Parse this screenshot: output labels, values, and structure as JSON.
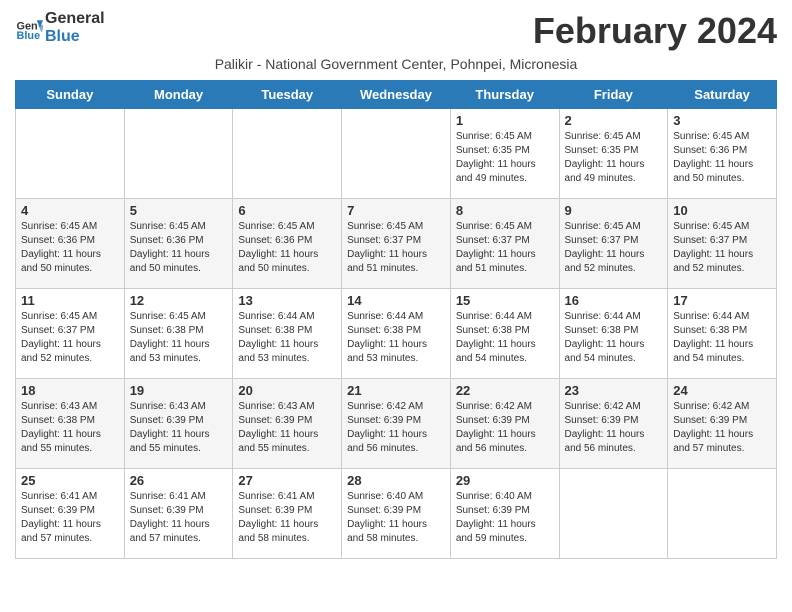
{
  "header": {
    "logo_line1": "General",
    "logo_line2": "Blue",
    "month_title": "February 2024",
    "subtitle": "Palikir - National Government Center, Pohnpei, Micronesia"
  },
  "days_of_week": [
    "Sunday",
    "Monday",
    "Tuesday",
    "Wednesday",
    "Thursday",
    "Friday",
    "Saturday"
  ],
  "weeks": [
    [
      {
        "day": "",
        "sunrise": "",
        "sunset": "",
        "daylight": ""
      },
      {
        "day": "",
        "sunrise": "",
        "sunset": "",
        "daylight": ""
      },
      {
        "day": "",
        "sunrise": "",
        "sunset": "",
        "daylight": ""
      },
      {
        "day": "",
        "sunrise": "",
        "sunset": "",
        "daylight": ""
      },
      {
        "day": "1",
        "sunrise": "6:45 AM",
        "sunset": "6:35 PM",
        "daylight": "11 hours and 49 minutes."
      },
      {
        "day": "2",
        "sunrise": "6:45 AM",
        "sunset": "6:35 PM",
        "daylight": "11 hours and 49 minutes."
      },
      {
        "day": "3",
        "sunrise": "6:45 AM",
        "sunset": "6:36 PM",
        "daylight": "11 hours and 50 minutes."
      }
    ],
    [
      {
        "day": "4",
        "sunrise": "6:45 AM",
        "sunset": "6:36 PM",
        "daylight": "11 hours and 50 minutes."
      },
      {
        "day": "5",
        "sunrise": "6:45 AM",
        "sunset": "6:36 PM",
        "daylight": "11 hours and 50 minutes."
      },
      {
        "day": "6",
        "sunrise": "6:45 AM",
        "sunset": "6:36 PM",
        "daylight": "11 hours and 50 minutes."
      },
      {
        "day": "7",
        "sunrise": "6:45 AM",
        "sunset": "6:37 PM",
        "daylight": "11 hours and 51 minutes."
      },
      {
        "day": "8",
        "sunrise": "6:45 AM",
        "sunset": "6:37 PM",
        "daylight": "11 hours and 51 minutes."
      },
      {
        "day": "9",
        "sunrise": "6:45 AM",
        "sunset": "6:37 PM",
        "daylight": "11 hours and 52 minutes."
      },
      {
        "day": "10",
        "sunrise": "6:45 AM",
        "sunset": "6:37 PM",
        "daylight": "11 hours and 52 minutes."
      }
    ],
    [
      {
        "day": "11",
        "sunrise": "6:45 AM",
        "sunset": "6:37 PM",
        "daylight": "11 hours and 52 minutes."
      },
      {
        "day": "12",
        "sunrise": "6:45 AM",
        "sunset": "6:38 PM",
        "daylight": "11 hours and 53 minutes."
      },
      {
        "day": "13",
        "sunrise": "6:44 AM",
        "sunset": "6:38 PM",
        "daylight": "11 hours and 53 minutes."
      },
      {
        "day": "14",
        "sunrise": "6:44 AM",
        "sunset": "6:38 PM",
        "daylight": "11 hours and 53 minutes."
      },
      {
        "day": "15",
        "sunrise": "6:44 AM",
        "sunset": "6:38 PM",
        "daylight": "11 hours and 54 minutes."
      },
      {
        "day": "16",
        "sunrise": "6:44 AM",
        "sunset": "6:38 PM",
        "daylight": "11 hours and 54 minutes."
      },
      {
        "day": "17",
        "sunrise": "6:44 AM",
        "sunset": "6:38 PM",
        "daylight": "11 hours and 54 minutes."
      }
    ],
    [
      {
        "day": "18",
        "sunrise": "6:43 AM",
        "sunset": "6:38 PM",
        "daylight": "11 hours and 55 minutes."
      },
      {
        "day": "19",
        "sunrise": "6:43 AM",
        "sunset": "6:39 PM",
        "daylight": "11 hours and 55 minutes."
      },
      {
        "day": "20",
        "sunrise": "6:43 AM",
        "sunset": "6:39 PM",
        "daylight": "11 hours and 55 minutes."
      },
      {
        "day": "21",
        "sunrise": "6:42 AM",
        "sunset": "6:39 PM",
        "daylight": "11 hours and 56 minutes."
      },
      {
        "day": "22",
        "sunrise": "6:42 AM",
        "sunset": "6:39 PM",
        "daylight": "11 hours and 56 minutes."
      },
      {
        "day": "23",
        "sunrise": "6:42 AM",
        "sunset": "6:39 PM",
        "daylight": "11 hours and 56 minutes."
      },
      {
        "day": "24",
        "sunrise": "6:42 AM",
        "sunset": "6:39 PM",
        "daylight": "11 hours and 57 minutes."
      }
    ],
    [
      {
        "day": "25",
        "sunrise": "6:41 AM",
        "sunset": "6:39 PM",
        "daylight": "11 hours and 57 minutes."
      },
      {
        "day": "26",
        "sunrise": "6:41 AM",
        "sunset": "6:39 PM",
        "daylight": "11 hours and 57 minutes."
      },
      {
        "day": "27",
        "sunrise": "6:41 AM",
        "sunset": "6:39 PM",
        "daylight": "11 hours and 58 minutes."
      },
      {
        "day": "28",
        "sunrise": "6:40 AM",
        "sunset": "6:39 PM",
        "daylight": "11 hours and 58 minutes."
      },
      {
        "day": "29",
        "sunrise": "6:40 AM",
        "sunset": "6:39 PM",
        "daylight": "11 hours and 59 minutes."
      },
      {
        "day": "",
        "sunrise": "",
        "sunset": "",
        "daylight": ""
      },
      {
        "day": "",
        "sunrise": "",
        "sunset": "",
        "daylight": ""
      }
    ]
  ]
}
